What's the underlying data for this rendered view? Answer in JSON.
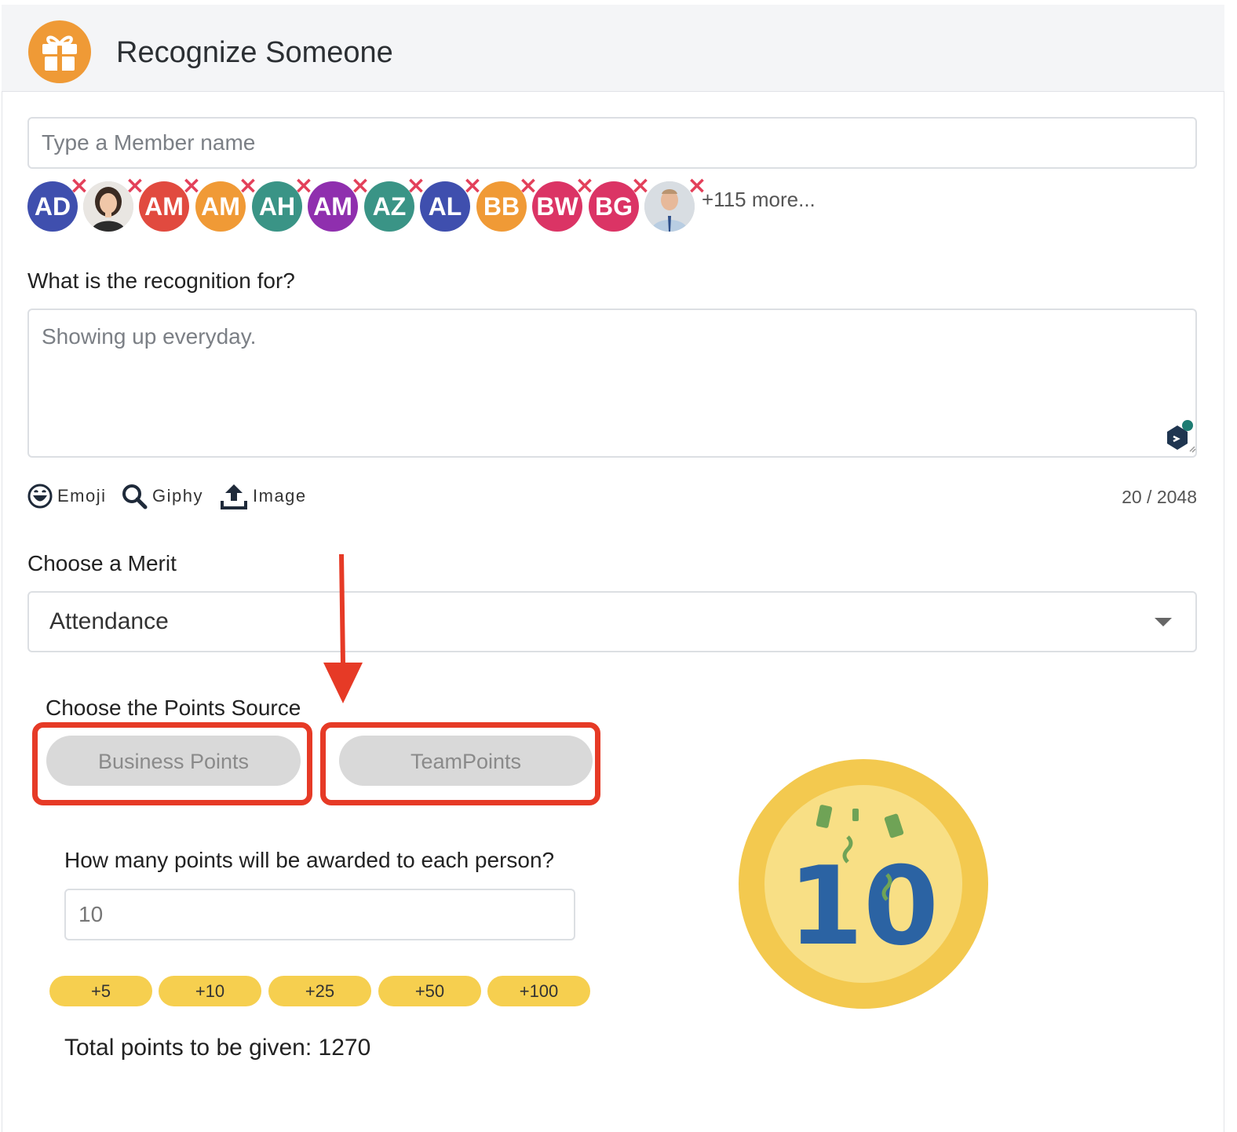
{
  "header": {
    "title": "Recognize Someone",
    "icon": "gift-icon"
  },
  "member_search": {
    "placeholder": "Type a Member name"
  },
  "recipients": [
    {
      "initials": "AD",
      "color": "#3f4fae"
    },
    {
      "initials": "",
      "photo": true,
      "icon": "female-avatar"
    },
    {
      "initials": "AM",
      "color": "#e14a3f"
    },
    {
      "initials": "AM",
      "color": "#f09a36"
    },
    {
      "initials": "AH",
      "color": "#3a9486"
    },
    {
      "initials": "AM",
      "color": "#8f2fae"
    },
    {
      "initials": "AZ",
      "color": "#3a9486"
    },
    {
      "initials": "AL",
      "color": "#3f4fae"
    },
    {
      "initials": "BB",
      "color": "#f09a36"
    },
    {
      "initials": "BW",
      "color": "#db3465"
    },
    {
      "initials": "BG",
      "color": "#db3465"
    },
    {
      "initials": "",
      "photo": true,
      "icon": "male-avatar"
    }
  ],
  "recipients_more": "+115 more...",
  "recognition": {
    "label": "What is the recognition for?",
    "placeholder": "Showing up everyday."
  },
  "tools": {
    "emoji": "Emoji",
    "giphy": "Giphy",
    "image": "Image"
  },
  "char_count": "20 / 2048",
  "merit": {
    "label": "Choose a Merit",
    "selected": "Attendance"
  },
  "points_source": {
    "label": "Choose the Points Source",
    "business": "Business Points",
    "team": "TeamPoints"
  },
  "points": {
    "label": "How many points will be awarded to each person?",
    "value": "10",
    "increments": [
      "+5",
      "+10",
      "+25",
      "+50",
      "+100"
    ],
    "total": "Total points to be given: 1270"
  },
  "coin": {
    "text": "10"
  },
  "colors": {
    "accent": "#ef9a36",
    "annotation": "#e63a26",
    "chip": "#f6cf4f",
    "coin_outer": "#f3c94f",
    "coin_inner": "#f8df85",
    "coin_digit": "#2b63a3"
  }
}
